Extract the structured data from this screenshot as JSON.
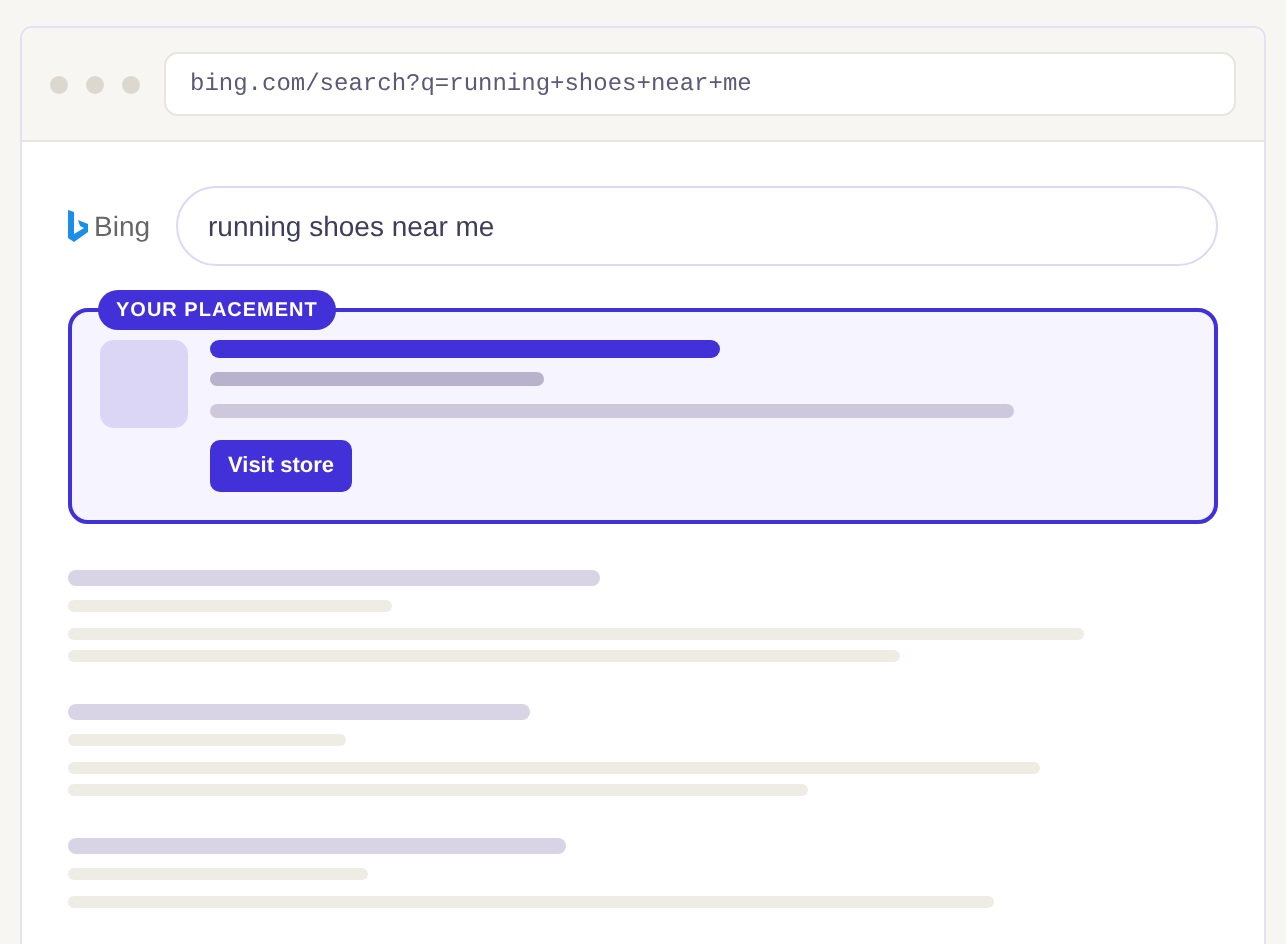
{
  "browser": {
    "address": "bing.com/search?q=running+shoes+near+me"
  },
  "search": {
    "logo_text": "Bing",
    "value": "running shoes near me"
  },
  "placement": {
    "badge": "YOUR PLACEMENT",
    "button": "Visit store"
  }
}
